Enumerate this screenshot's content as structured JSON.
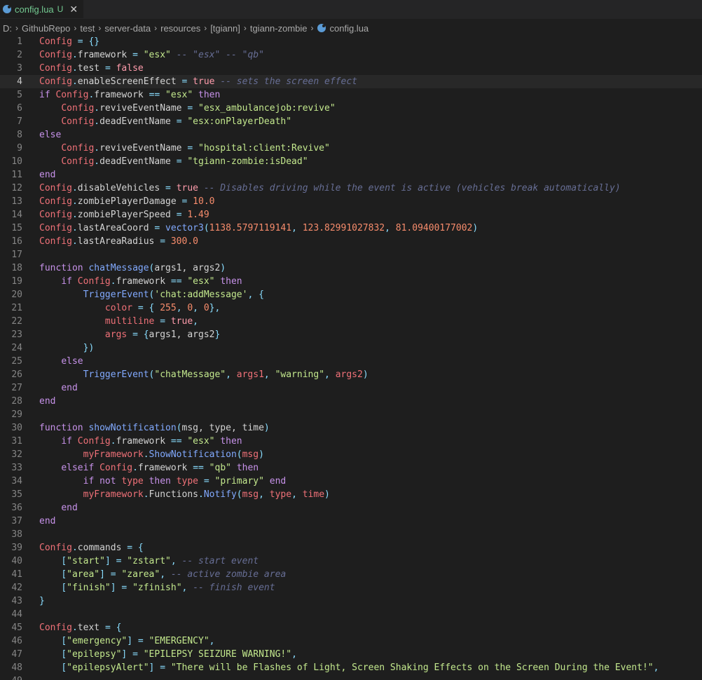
{
  "tab": {
    "label": "config.lua",
    "status": "U",
    "close": "✕"
  },
  "breadcrumb": {
    "items": [
      "D:",
      "GithubRepo",
      "test",
      "server-data",
      "resources",
      "[tgiann]",
      "tgiann-zombie",
      "config.lua"
    ]
  },
  "editor": {
    "current_line": 4,
    "lines": [
      [
        [
          "k",
          "Config"
        ],
        [
          "pa",
          " "
        ],
        [
          "p",
          "="
        ],
        [
          "pa",
          " "
        ],
        [
          "p",
          "{}"
        ]
      ],
      [
        [
          "k",
          "Config"
        ],
        [
          "p",
          "."
        ],
        [
          "pa",
          "framework "
        ],
        [
          "p",
          "="
        ],
        [
          "pa",
          " "
        ],
        [
          "s",
          "\"esx\""
        ],
        [
          "pa",
          " "
        ],
        [
          "c",
          "-- \"esx\" -- \"qb\""
        ]
      ],
      [
        [
          "k",
          "Config"
        ],
        [
          "p",
          "."
        ],
        [
          "pa",
          "test "
        ],
        [
          "p",
          "="
        ],
        [
          "pa",
          " "
        ],
        [
          "b",
          "false"
        ]
      ],
      [
        [
          "k",
          "Config"
        ],
        [
          "p",
          "."
        ],
        [
          "pa",
          "enableScreenEffect "
        ],
        [
          "p",
          "="
        ],
        [
          "pa",
          " "
        ],
        [
          "b",
          "true"
        ],
        [
          "pa",
          " "
        ],
        [
          "c",
          "-- sets the screen effect"
        ]
      ],
      [
        [
          "kw",
          "if"
        ],
        [
          "pa",
          " "
        ],
        [
          "k",
          "Config"
        ],
        [
          "p",
          "."
        ],
        [
          "pa",
          "framework "
        ],
        [
          "p",
          "=="
        ],
        [
          "pa",
          " "
        ],
        [
          "s",
          "\"esx\""
        ],
        [
          "pa",
          " "
        ],
        [
          "kw",
          "then"
        ]
      ],
      [
        [
          "pa",
          "    "
        ],
        [
          "k",
          "Config"
        ],
        [
          "p",
          "."
        ],
        [
          "pa",
          "reviveEventName "
        ],
        [
          "p",
          "="
        ],
        [
          "pa",
          " "
        ],
        [
          "s",
          "\"esx_ambulancejob:revive\""
        ]
      ],
      [
        [
          "pa",
          "    "
        ],
        [
          "k",
          "Config"
        ],
        [
          "p",
          "."
        ],
        [
          "pa",
          "deadEventName "
        ],
        [
          "p",
          "="
        ],
        [
          "pa",
          " "
        ],
        [
          "s",
          "\"esx:onPlayerDeath\""
        ]
      ],
      [
        [
          "kw",
          "else"
        ]
      ],
      [
        [
          "pa",
          "    "
        ],
        [
          "k",
          "Config"
        ],
        [
          "p",
          "."
        ],
        [
          "pa",
          "reviveEventName "
        ],
        [
          "p",
          "="
        ],
        [
          "pa",
          " "
        ],
        [
          "s",
          "\"hospital:client:Revive\""
        ]
      ],
      [
        [
          "pa",
          "    "
        ],
        [
          "k",
          "Config"
        ],
        [
          "p",
          "."
        ],
        [
          "pa",
          "deadEventName "
        ],
        [
          "p",
          "="
        ],
        [
          "pa",
          " "
        ],
        [
          "s",
          "\"tgiann-zombie:isDead\""
        ]
      ],
      [
        [
          "kw",
          "end"
        ]
      ],
      [
        [
          "k",
          "Config"
        ],
        [
          "p",
          "."
        ],
        [
          "pa",
          "disableVehicles "
        ],
        [
          "p",
          "="
        ],
        [
          "pa",
          " "
        ],
        [
          "b",
          "true"
        ],
        [
          "pa",
          " "
        ],
        [
          "c",
          "-- Disables driving while the event is active (vehicles break automatically)"
        ]
      ],
      [
        [
          "k",
          "Config"
        ],
        [
          "p",
          "."
        ],
        [
          "pa",
          "zombiePlayerDamage "
        ],
        [
          "p",
          "="
        ],
        [
          "pa",
          " "
        ],
        [
          "n",
          "10.0"
        ]
      ],
      [
        [
          "k",
          "Config"
        ],
        [
          "p",
          "."
        ],
        [
          "pa",
          "zombiePlayerSpeed "
        ],
        [
          "p",
          "="
        ],
        [
          "pa",
          " "
        ],
        [
          "n",
          "1.49"
        ]
      ],
      [
        [
          "k",
          "Config"
        ],
        [
          "p",
          "."
        ],
        [
          "pa",
          "lastAreaCoord "
        ],
        [
          "p",
          "="
        ],
        [
          "pa",
          " "
        ],
        [
          "f",
          "vector3"
        ],
        [
          "p",
          "("
        ],
        [
          "n",
          "1138.5797119141"
        ],
        [
          "p",
          ", "
        ],
        [
          "n",
          "123.82991027832"
        ],
        [
          "p",
          ", "
        ],
        [
          "n",
          "81.09400177002"
        ],
        [
          "p",
          ")"
        ]
      ],
      [
        [
          "k",
          "Config"
        ],
        [
          "p",
          "."
        ],
        [
          "pa",
          "lastAreaRadius "
        ],
        [
          "p",
          "="
        ],
        [
          "pa",
          " "
        ],
        [
          "n",
          "300.0"
        ]
      ],
      [],
      [
        [
          "kw",
          "function"
        ],
        [
          "pa",
          " "
        ],
        [
          "f",
          "chatMessage"
        ],
        [
          "p",
          "("
        ],
        [
          "pa",
          "args1, args2"
        ],
        [
          "p",
          ")"
        ]
      ],
      [
        [
          "pa",
          "    "
        ],
        [
          "kw",
          "if"
        ],
        [
          "pa",
          " "
        ],
        [
          "k",
          "Config"
        ],
        [
          "p",
          "."
        ],
        [
          "pa",
          "framework "
        ],
        [
          "p",
          "=="
        ],
        [
          "pa",
          " "
        ],
        [
          "s",
          "\"esx\""
        ],
        [
          "pa",
          " "
        ],
        [
          "kw",
          "then"
        ]
      ],
      [
        [
          "pa",
          "        "
        ],
        [
          "f",
          "TriggerEvent"
        ],
        [
          "p",
          "("
        ],
        [
          "s",
          "'chat:addMessage'"
        ],
        [
          "p",
          ", {"
        ]
      ],
      [
        [
          "pa",
          "            "
        ],
        [
          "k",
          "color"
        ],
        [
          "pa",
          " "
        ],
        [
          "p",
          "="
        ],
        [
          "pa",
          " "
        ],
        [
          "p",
          "{ "
        ],
        [
          "n",
          "255"
        ],
        [
          "p",
          ", "
        ],
        [
          "n",
          "0"
        ],
        [
          "p",
          ", "
        ],
        [
          "n",
          "0"
        ],
        [
          "p",
          "},"
        ]
      ],
      [
        [
          "pa",
          "            "
        ],
        [
          "k",
          "multiline"
        ],
        [
          "pa",
          " "
        ],
        [
          "p",
          "="
        ],
        [
          "pa",
          " "
        ],
        [
          "b",
          "true"
        ],
        [
          "p",
          ","
        ]
      ],
      [
        [
          "pa",
          "            "
        ],
        [
          "k",
          "args"
        ],
        [
          "pa",
          " "
        ],
        [
          "p",
          "="
        ],
        [
          "pa",
          " "
        ],
        [
          "p",
          "{"
        ],
        [
          "pa",
          "args1, args2"
        ],
        [
          "p",
          "}"
        ]
      ],
      [
        [
          "pa",
          "        "
        ],
        [
          "p",
          "})"
        ]
      ],
      [
        [
          "pa",
          "    "
        ],
        [
          "kw",
          "else"
        ]
      ],
      [
        [
          "pa",
          "        "
        ],
        [
          "f",
          "TriggerEvent"
        ],
        [
          "p",
          "("
        ],
        [
          "s",
          "\"chatMessage\""
        ],
        [
          "p",
          ", "
        ],
        [
          "k",
          "args1"
        ],
        [
          "p",
          ", "
        ],
        [
          "s",
          "\"warning\""
        ],
        [
          "p",
          ", "
        ],
        [
          "k",
          "args2"
        ],
        [
          "p",
          ")"
        ]
      ],
      [
        [
          "pa",
          "    "
        ],
        [
          "kw",
          "end"
        ]
      ],
      [
        [
          "kw",
          "end"
        ]
      ],
      [],
      [
        [
          "kw",
          "function"
        ],
        [
          "pa",
          " "
        ],
        [
          "f",
          "showNotification"
        ],
        [
          "p",
          "("
        ],
        [
          "pa",
          "msg, type, time"
        ],
        [
          "p",
          ")"
        ]
      ],
      [
        [
          "pa",
          "    "
        ],
        [
          "kw",
          "if"
        ],
        [
          "pa",
          " "
        ],
        [
          "k",
          "Config"
        ],
        [
          "p",
          "."
        ],
        [
          "pa",
          "framework "
        ],
        [
          "p",
          "=="
        ],
        [
          "pa",
          " "
        ],
        [
          "s",
          "\"esx\""
        ],
        [
          "pa",
          " "
        ],
        [
          "kw",
          "then"
        ]
      ],
      [
        [
          "pa",
          "        "
        ],
        [
          "k",
          "myFramework"
        ],
        [
          "p",
          "."
        ],
        [
          "f",
          "ShowNotification"
        ],
        [
          "p",
          "("
        ],
        [
          "k",
          "msg"
        ],
        [
          "p",
          ")"
        ]
      ],
      [
        [
          "pa",
          "    "
        ],
        [
          "kw",
          "elseif"
        ],
        [
          "pa",
          " "
        ],
        [
          "k",
          "Config"
        ],
        [
          "p",
          "."
        ],
        [
          "pa",
          "framework "
        ],
        [
          "p",
          "=="
        ],
        [
          "pa",
          " "
        ],
        [
          "s",
          "\"qb\""
        ],
        [
          "pa",
          " "
        ],
        [
          "kw",
          "then"
        ]
      ],
      [
        [
          "pa",
          "        "
        ],
        [
          "kw",
          "if not"
        ],
        [
          "pa",
          " "
        ],
        [
          "k",
          "type"
        ],
        [
          "pa",
          " "
        ],
        [
          "kw",
          "then"
        ],
        [
          "pa",
          " "
        ],
        [
          "k",
          "type"
        ],
        [
          "pa",
          " "
        ],
        [
          "p",
          "="
        ],
        [
          "pa",
          " "
        ],
        [
          "s",
          "\"primary\""
        ],
        [
          "pa",
          " "
        ],
        [
          "kw",
          "end"
        ]
      ],
      [
        [
          "pa",
          "        "
        ],
        [
          "k",
          "myFramework"
        ],
        [
          "p",
          "."
        ],
        [
          "pa",
          "Functions"
        ],
        [
          "p",
          "."
        ],
        [
          "f",
          "Notify"
        ],
        [
          "p",
          "("
        ],
        [
          "k",
          "msg"
        ],
        [
          "p",
          ", "
        ],
        [
          "k",
          "type"
        ],
        [
          "p",
          ", "
        ],
        [
          "k",
          "time"
        ],
        [
          "p",
          ")"
        ]
      ],
      [
        [
          "pa",
          "    "
        ],
        [
          "kw",
          "end"
        ]
      ],
      [
        [
          "kw",
          "end"
        ]
      ],
      [],
      [
        [
          "k",
          "Config"
        ],
        [
          "p",
          "."
        ],
        [
          "pa",
          "commands "
        ],
        [
          "p",
          "="
        ],
        [
          "pa",
          " "
        ],
        [
          "p",
          "{"
        ]
      ],
      [
        [
          "pa",
          "    "
        ],
        [
          "p",
          "["
        ],
        [
          "s",
          "\"start\""
        ],
        [
          "p",
          "]"
        ],
        [
          "pa",
          " "
        ],
        [
          "p",
          "="
        ],
        [
          "pa",
          " "
        ],
        [
          "s",
          "\"zstart\""
        ],
        [
          "p",
          ","
        ],
        [
          "pa",
          " "
        ],
        [
          "c",
          "-- start event"
        ]
      ],
      [
        [
          "pa",
          "    "
        ],
        [
          "p",
          "["
        ],
        [
          "s",
          "\"area\""
        ],
        [
          "p",
          "]"
        ],
        [
          "pa",
          " "
        ],
        [
          "p",
          "="
        ],
        [
          "pa",
          " "
        ],
        [
          "s",
          "\"zarea\""
        ],
        [
          "p",
          ","
        ],
        [
          "pa",
          " "
        ],
        [
          "c",
          "-- active zombie area"
        ]
      ],
      [
        [
          "pa",
          "    "
        ],
        [
          "p",
          "["
        ],
        [
          "s",
          "\"finish\""
        ],
        [
          "p",
          "]"
        ],
        [
          "pa",
          " "
        ],
        [
          "p",
          "="
        ],
        [
          "pa",
          " "
        ],
        [
          "s",
          "\"zfinish\""
        ],
        [
          "p",
          ","
        ],
        [
          "pa",
          " "
        ],
        [
          "c",
          "-- finish event"
        ]
      ],
      [
        [
          "p",
          "}"
        ]
      ],
      [],
      [
        [
          "k",
          "Config"
        ],
        [
          "p",
          "."
        ],
        [
          "pa",
          "text "
        ],
        [
          "p",
          "="
        ],
        [
          "pa",
          " "
        ],
        [
          "p",
          "{"
        ]
      ],
      [
        [
          "pa",
          "    "
        ],
        [
          "p",
          "["
        ],
        [
          "s",
          "\"emergency\""
        ],
        [
          "p",
          "]"
        ],
        [
          "pa",
          " "
        ],
        [
          "p",
          "="
        ],
        [
          "pa",
          " "
        ],
        [
          "s",
          "\"EMERGENCY\""
        ],
        [
          "p",
          ","
        ]
      ],
      [
        [
          "pa",
          "    "
        ],
        [
          "p",
          "["
        ],
        [
          "s",
          "\"epilepsy\""
        ],
        [
          "p",
          "]"
        ],
        [
          "pa",
          " "
        ],
        [
          "p",
          "="
        ],
        [
          "pa",
          " "
        ],
        [
          "s",
          "\"EPILEPSY SEIZURE WARNING!\""
        ],
        [
          "p",
          ","
        ]
      ],
      [
        [
          "pa",
          "    "
        ],
        [
          "p",
          "["
        ],
        [
          "s",
          "\"epilepsyAlert\""
        ],
        [
          "p",
          "]"
        ],
        [
          "pa",
          " "
        ],
        [
          "p",
          "="
        ],
        [
          "pa",
          " "
        ],
        [
          "s",
          "\"There will be Flashes of Light, Screen Shaking Effects on the Screen During the Event!\""
        ],
        [
          "p",
          ","
        ]
      ],
      [
        [
          "pa",
          "    "
        ]
      ]
    ]
  }
}
